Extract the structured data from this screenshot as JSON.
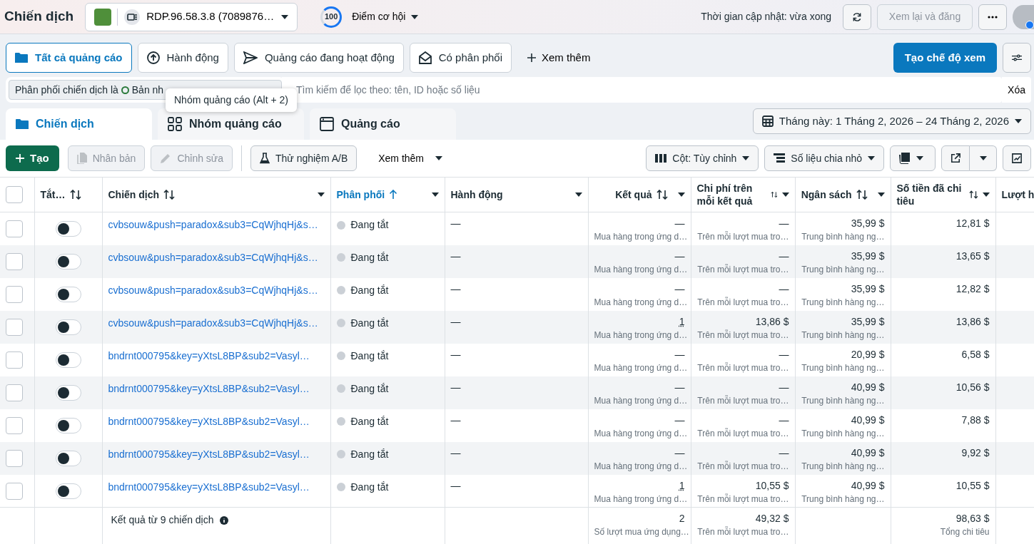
{
  "header": {
    "title": "Chiến dịch",
    "account": "RDP.96.58.3.8 (7089876…",
    "score": "100",
    "score_label": "Điểm cơ hội",
    "update_text": "Thời gian cập nhật: vừa xong",
    "review_button": {
      "label": "Xem lại và đăng",
      "disabled": true
    }
  },
  "view_tabs": [
    {
      "label": "Tất cả quảng cáo",
      "selected": true
    },
    {
      "label": "Hành động",
      "selected": false
    },
    {
      "label": "Quảng cáo đang hoạt động",
      "selected": false
    },
    {
      "label": "Có phân phối",
      "selected": false
    }
  ],
  "more_views": "Xem thêm",
  "create_view": "Tạo chế độ xem",
  "filter": {
    "chip_label": "Phân phối chiến dịch là",
    "chip_value": "Bản nh",
    "placeholder": "Tìm kiếm để lọc theo: tên, ID hoặc số liệu",
    "clear": "Xóa"
  },
  "tooltip": "Nhóm quảng cáo (Alt + 2)",
  "level_tabs": [
    {
      "label": "Chiến dịch",
      "selected": true
    },
    {
      "label": "Nhóm quảng cáo",
      "selected": false
    },
    {
      "label": "Quảng cáo",
      "selected": false
    }
  ],
  "date_range": "Tháng này: 1 Tháng 2, 2026 – 24 Tháng 2, 2026",
  "toolbar": {
    "create": "Tạo",
    "duplicate": {
      "label": "Nhân bản",
      "disabled": true
    },
    "edit": {
      "label": "Chỉnh sửa",
      "disabled": true
    },
    "ab_test": "Thử nghiệm A/B",
    "more": "Xem thêm",
    "columns": "Cột: Tùy chỉnh",
    "breakdown": "Số liệu chia nhỏ"
  },
  "table": {
    "select_all_checked": false,
    "columns": [
      {
        "label": "Tắt…",
        "sortable": true,
        "menu": false,
        "selected": false
      },
      {
        "label": "Chiến dịch",
        "sortable": true,
        "menu": true,
        "selected": false
      },
      {
        "label": "Phân phối",
        "sortable": true,
        "menu": true,
        "selected": true
      },
      {
        "label": "Hành động",
        "sortable": false,
        "menu": true,
        "selected": false
      },
      {
        "label": "Kết quả",
        "sortable": true,
        "menu": true,
        "selected": false
      },
      {
        "label": "Chi phí trên mỗi kết quả",
        "sortable": true,
        "menu": true,
        "selected": false
      },
      {
        "label": "Ngân sách",
        "sortable": true,
        "menu": true,
        "selected": false
      },
      {
        "label": "Số tiền đã chi tiêu",
        "sortable": true,
        "menu": true,
        "selected": false
      },
      {
        "label": "Lượt h",
        "sortable": false,
        "menu": false,
        "selected": false
      }
    ],
    "rows": [
      {
        "checked": false,
        "on": false,
        "name": "cvbsouw&push=paradox&sub3=CqWjhqHj&s…",
        "delivery": "Đang tắt",
        "actions": "—",
        "result": "—",
        "result_note": "Mua hàng trong ứng d…",
        "cost": "—",
        "cost_note": "Trên mỗi lượt mua tro…",
        "budget": "35,99 $",
        "budget_note": "Trung bình hàng ng…",
        "spent": "12,81 $"
      },
      {
        "checked": false,
        "on": false,
        "name": "cvbsouw&push=paradox&sub3=CqWjhqHj&s…",
        "delivery": "Đang tắt",
        "actions": "—",
        "result": "—",
        "result_note": "Mua hàng trong ứng d…",
        "cost": "—",
        "cost_note": "Trên mỗi lượt mua tro…",
        "budget": "35,99 $",
        "budget_note": "Trung bình hàng ng…",
        "spent": "13,65 $"
      },
      {
        "checked": false,
        "on": false,
        "name": "cvbsouw&push=paradox&sub3=CqWjhqHj&s…",
        "delivery": "Đang tắt",
        "actions": "—",
        "result": "—",
        "result_note": "Mua hàng trong ứng d…",
        "cost": "—",
        "cost_note": "Trên mỗi lượt mua tro…",
        "budget": "35,99 $",
        "budget_note": "Trung bình hàng ng…",
        "spent": "12,82 $"
      },
      {
        "checked": false,
        "on": false,
        "name": "cvbsouw&push=paradox&sub3=CqWjhqHj&s…",
        "delivery": "Đang tắt",
        "actions": "—",
        "result": "1",
        "result_note": "Mua hàng trong ứng d…",
        "cost": "13,86 $",
        "cost_note": "Trên mỗi lượt mua tro…",
        "budget": "35,99 $",
        "budget_note": "Trung bình hàng ng…",
        "spent": "13,86 $"
      },
      {
        "checked": false,
        "on": false,
        "name": "bndrnt000795&key=yXtsL8BP&sub2=Vasyl…",
        "delivery": "Đang tắt",
        "actions": "—",
        "result": "—",
        "result_note": "Mua hàng trong ứng d…",
        "cost": "—",
        "cost_note": "Trên mỗi lượt mua tro…",
        "budget": "20,99 $",
        "budget_note": "Trung bình hàng ng…",
        "spent": "6,58 $"
      },
      {
        "checked": false,
        "on": false,
        "name": "bndrnt000795&key=yXtsL8BP&sub2=Vasyl…",
        "delivery": "Đang tắt",
        "actions": "—",
        "result": "—",
        "result_note": "Mua hàng trong ứng d…",
        "cost": "—",
        "cost_note": "Trên mỗi lượt mua tro…",
        "budget": "40,99 $",
        "budget_note": "Trung bình hàng ng…",
        "spent": "10,56 $"
      },
      {
        "checked": false,
        "on": false,
        "name": "bndrnt000795&key=yXtsL8BP&sub2=Vasyl…",
        "delivery": "Đang tắt",
        "actions": "—",
        "result": "—",
        "result_note": "Mua hàng trong ứng d…",
        "cost": "—",
        "cost_note": "Trên mỗi lượt mua tro…",
        "budget": "40,99 $",
        "budget_note": "Trung bình hàng ng…",
        "spent": "7,88 $"
      },
      {
        "checked": false,
        "on": false,
        "name": "bndrnt000795&key=yXtsL8BP&sub2=Vasyl…",
        "delivery": "Đang tắt",
        "actions": "—",
        "result": "—",
        "result_note": "Mua hàng trong ứng d…",
        "cost": "—",
        "cost_note": "Trên mỗi lượt mua tro…",
        "budget": "40,99 $",
        "budget_note": "Trung bình hàng ng…",
        "spent": "9,92 $"
      },
      {
        "checked": false,
        "on": false,
        "name": "bndrnt000795&key=yXtsL8BP&sub2=Vasyl…",
        "delivery": "Đang tắt",
        "actions": "—",
        "result": "1",
        "result_note": "Mua hàng trong ứng d…",
        "cost": "10,55 $",
        "cost_note": "Trên mỗi lượt mua tro…",
        "budget": "40,99 $",
        "budget_note": "Trung bình hàng ng…",
        "spent": "10,55 $"
      }
    ],
    "footer": {
      "label": "Kết quả từ 9 chiến dịch",
      "result": "2",
      "result_note": "Số lượt mua ứng dụng…",
      "cost": "49,32 $",
      "cost_note": "Trên mỗi lượt mua tro…",
      "spent": "98,63 $",
      "spent_note": "Tổng chi tiêu"
    }
  }
}
